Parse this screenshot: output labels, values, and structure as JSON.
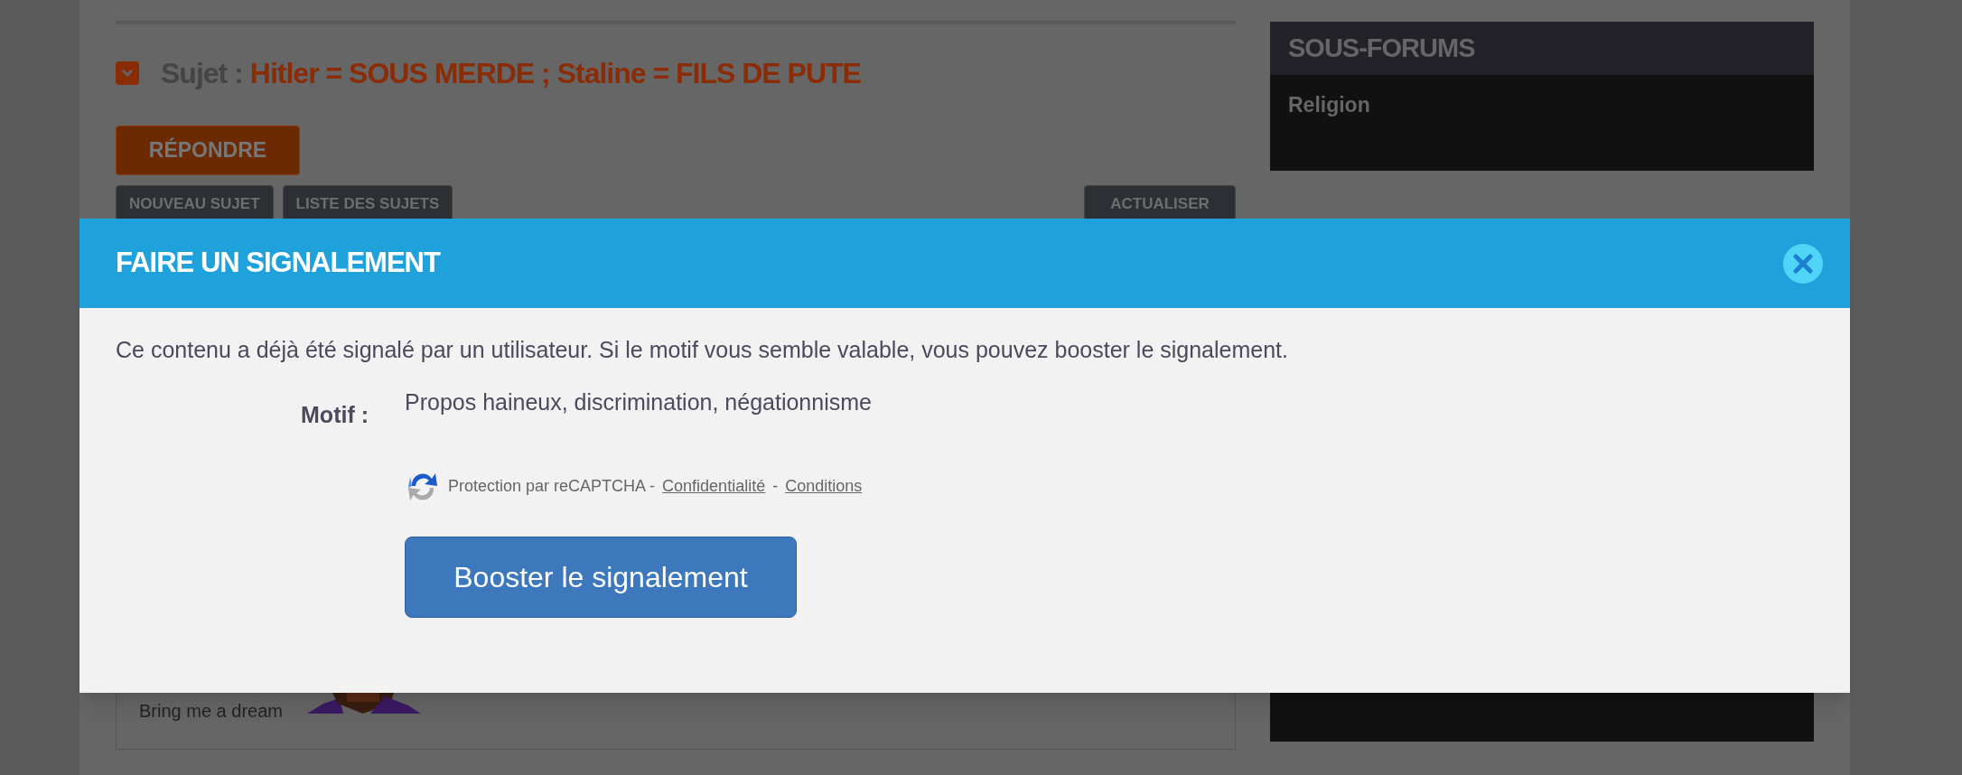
{
  "topic": {
    "label": "Sujet :",
    "title": "Hitler = SOUS MERDE ; Staline = FILS DE PUTE"
  },
  "reply_button": "RÉPONDRE",
  "toolbar": {
    "left": [
      "NOUVEAU SUJET",
      "LISTE DES SUJETS"
    ],
    "right": [
      "ACTUALISER"
    ]
  },
  "sidebar": {
    "title": "SOUS-FORUMS",
    "items": [
      "Religion"
    ]
  },
  "post": {
    "signature": "Bring me a dream"
  },
  "modal": {
    "title": "FAIRE UN SIGNALEMENT",
    "message": "Ce contenu a déjà été signalé par un utilisateur. Si le motif vous semble valable, vous pouvez booster le signalement.",
    "reason_label": "Motif :",
    "reason": "Propos haineux, discrimination, négationnisme",
    "recaptcha": {
      "text": "Protection par reCAPTCHA -",
      "links": [
        "Confidentialité",
        "Conditions"
      ],
      "separator": "-"
    },
    "button": "Booster le signalement"
  }
}
